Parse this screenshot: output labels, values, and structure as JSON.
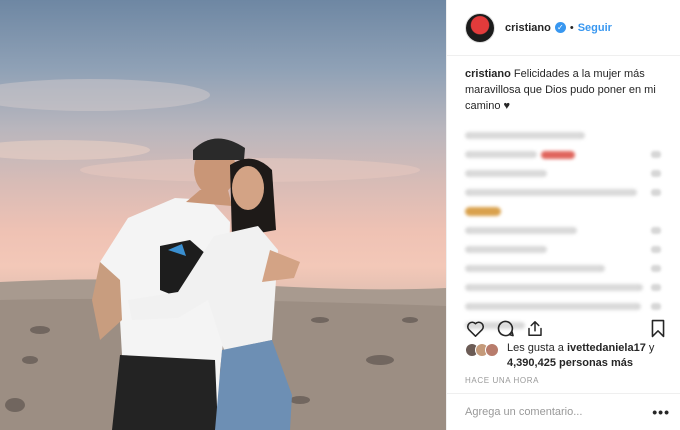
{
  "header": {
    "username": "cristiano",
    "verified_icon": "verified-badge-icon",
    "separator": "•",
    "follow_label": "Seguir"
  },
  "caption": {
    "username": "cristiano",
    "text": "Felicidades a la mujer más maravillosa que Dios pudo poner en mi camino ♥"
  },
  "actions": {
    "like_icon": "heart-outline-icon",
    "comment_icon": "comment-bubble-icon",
    "share_icon": "share-upload-icon",
    "save_icon": "bookmark-icon"
  },
  "likes": {
    "prefix": "Les gusta a",
    "user": "ivettedaniela17",
    "conjunction": "y",
    "count": "4,390,425",
    "suffix": "personas más"
  },
  "timestamp": "HACE UNA HORA",
  "comment_input": {
    "placeholder": "Agrega un comentario..."
  },
  "more_label": "•••",
  "colors": {
    "link_blue": "#3897f0",
    "border": "#efefef",
    "muted_text": "#999999"
  }
}
